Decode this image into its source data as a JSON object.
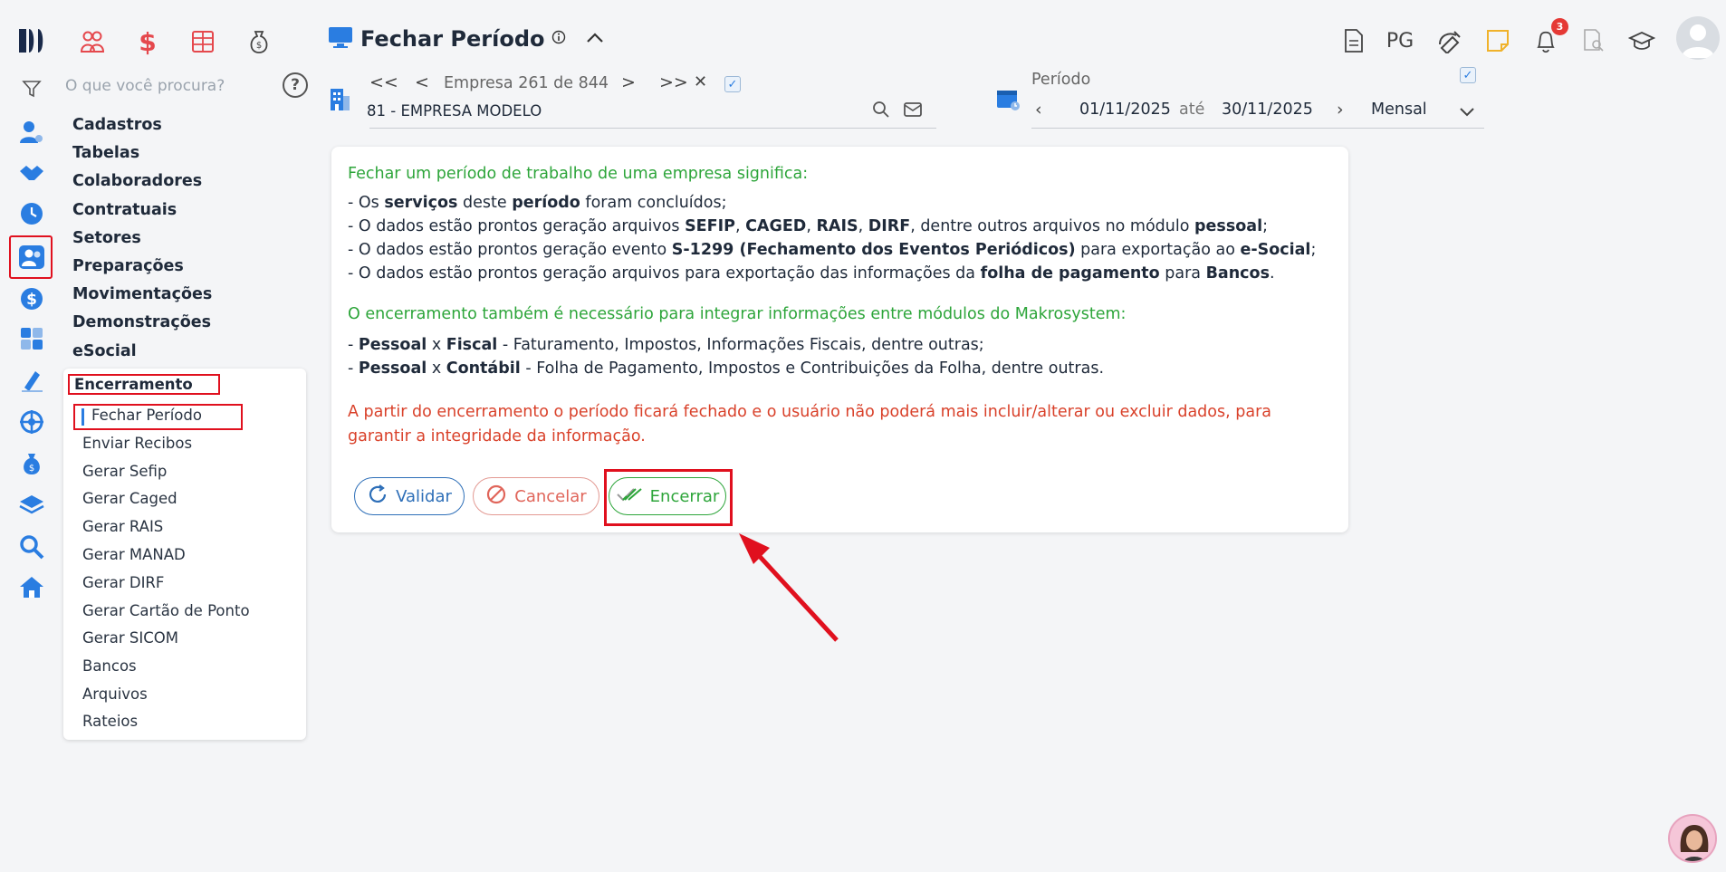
{
  "app": {
    "search_placeholder": "O que você procura?",
    "help": "?"
  },
  "header": {
    "title": "Fechar Período",
    "pg_label": "PG",
    "notifications_count": "3"
  },
  "empresa": {
    "nav_first": "<<",
    "nav_prev": "<",
    "label": "Empresa 261 de 844",
    "nav_next": ">",
    "nav_last": ">>",
    "clear": "✕",
    "name": "81 - EMPRESA MODELO"
  },
  "periodo": {
    "label": "Período",
    "start": "01/11/2025",
    "sep": "até",
    "end": "30/11/2025",
    "type": "Mensal"
  },
  "menu": {
    "items": [
      "Cadastros",
      "Tabelas",
      "Colaboradores",
      "Contratuais",
      "Setores",
      "Preparações",
      "Movimentações",
      "Demonstrações",
      "eSocial"
    ],
    "section": "Encerramento",
    "sub_items": [
      "Fechar Período",
      "Enviar Recibos",
      "Gerar Sefip",
      "Gerar Caged",
      "Gerar RAIS",
      "Gerar MANAD",
      "Gerar DIRF",
      "Gerar Cartão de Ponto",
      "Gerar SICOM",
      "Bancos",
      "Arquivos",
      "Rateios"
    ]
  },
  "card": {
    "intro": "Fechar um período de trabalho de uma empresa significa:",
    "l1": {
      "a": "- Os ",
      "b": "serviços",
      "c": " deste ",
      "d": "período",
      "e": " foram concluídos;"
    },
    "l2": {
      "a": "- O dados estão prontos geração arquivos ",
      "b": "SEFIP",
      "c": ", ",
      "d": "CAGED",
      "e": ", ",
      "f": "RAIS",
      "g": ", ",
      "h": "DIRF",
      "i": ", dentre outros arquivos no módulo ",
      "j": "pessoal",
      "k": ";"
    },
    "l3": {
      "a": "- O dados estão prontos geração evento ",
      "b": "S-1299 (Fechamento dos Eventos Periódicos)",
      "c": " para exportação ao ",
      "d": "e-Social",
      "e": ";"
    },
    "l4": {
      "a": "- O dados estão prontos geração arquivos para exportação das informações da ",
      "b": "folha de pagamento",
      "c": " para ",
      "d": "Bancos",
      "e": "."
    },
    "integration": "O encerramento também é necessário para integrar informações entre módulos do Makrosystem:",
    "i1": {
      "a": "- ",
      "b": "Pessoal",
      "c": " x ",
      "d": "Fiscal",
      "e": " - Faturamento, Impostos, Informações Fiscais, dentre outras;"
    },
    "i2": {
      "a": "- ",
      "b": "Pessoal",
      "c": " x ",
      "d": "Contábil",
      "e": " - Folha de Pagamento, Impostos e Contribuições da Folha, dentre outras."
    },
    "warning_1": "A partir do encerramento o período ficará fechado e o usuário não poderá mais incluir/alterar ou excluir dados, para",
    "warning_2": "garantir a integridade da informação.",
    "btn_validar": "Validar",
    "btn_cancelar": "Cancelar",
    "btn_encerrar": "Encerrar"
  },
  "colors": {
    "accent_red": "#e0101e",
    "green": "#2da53a",
    "warning_red": "#d9412a",
    "blue": "#2e6fb8"
  }
}
